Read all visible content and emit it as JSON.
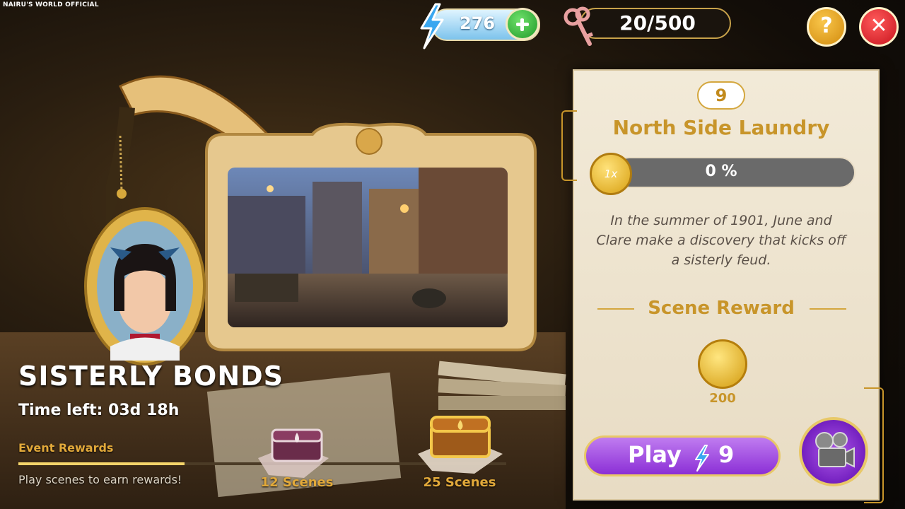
{
  "watermark": "NAIRU'S WORLD OFFICIAL",
  "hud": {
    "energy": "276",
    "keys": "20/500"
  },
  "event": {
    "title": "SISTERLY BONDS",
    "time_left": "Time left: 03d 18h",
    "rewards_label": "Event Rewards",
    "rewards_progress": 0.34,
    "hint": "Play scenes to earn rewards!",
    "milestones": [
      {
        "label": "12 Scenes"
      },
      {
        "label": "25 Scenes"
      }
    ]
  },
  "scene": {
    "level": "9",
    "title": "North Side Laundry",
    "multiplier": "1x",
    "progress_text": "0 %",
    "progress": 0,
    "description": "In the summer of 1901, June and Clare make a discovery that kicks off a sisterly feud.",
    "reward_title": "Scene Reward",
    "reward_amount": "200",
    "play_label": "Play",
    "play_cost": "9"
  },
  "colors": {
    "accent_gold": "#c8952a",
    "play_purple": "#8b2fd6",
    "close_red": "#c8141e",
    "energy_green": "#1f9a2a"
  },
  "icons": [
    "bolt-icon",
    "plus-icon",
    "key-icon",
    "help-icon",
    "close-icon",
    "coin-icon",
    "camera-icon",
    "chest-icon"
  ]
}
